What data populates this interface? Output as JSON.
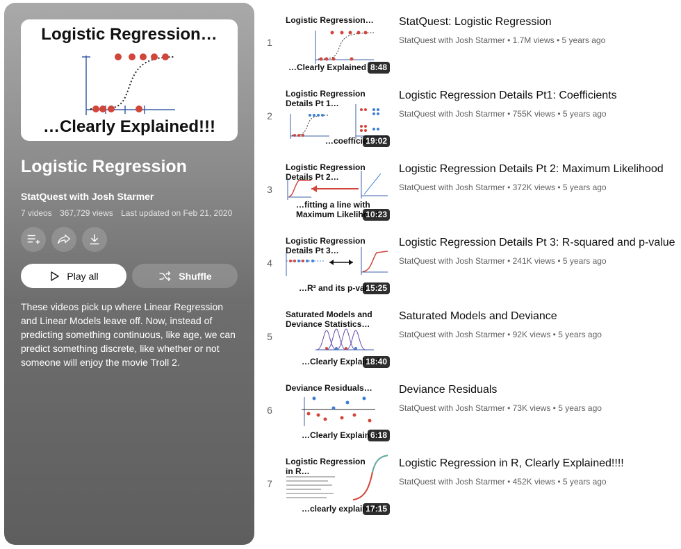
{
  "playlist": {
    "hero_title_top": "Logistic Regression…",
    "hero_title_bottom": "…Clearly Explained!!!",
    "title": "Logistic Regression",
    "owner": "StatQuest with Josh Starmer",
    "video_count": "7 videos",
    "views": "367,729 views",
    "updated": "Last updated on Feb 21, 2020",
    "play_all_label": "Play all",
    "shuffle_label": "Shuffle",
    "description": "These videos pick up where Linear Regression and Linear Models leave off. Now, instead of predicting something continuous, like age, we can predict something discrete, like whether or not someone will enjoy the movie Troll 2.",
    "icons": [
      "add-to-queue-icon",
      "share-icon",
      "download-icon",
      "play-icon",
      "shuffle-icon"
    ]
  },
  "videos": [
    {
      "index": "1",
      "title": "StatQuest: Logistic Regression",
      "channel": "StatQuest with Josh Starmer",
      "views": "1.7M views",
      "age": "5 years ago",
      "duration": "8:48",
      "thumb_top": "Logistic Regression…",
      "thumb_bottom": "…Clearly Explained"
    },
    {
      "index": "2",
      "title": "Logistic Regression Details Pt1: Coefficients",
      "channel": "StatQuest with Josh Starmer",
      "views": "755K views",
      "age": "5 years ago",
      "duration": "19:02",
      "thumb_top": "Logistic Regression\nDetails Pt 1…",
      "thumb_bottom": "…coefficients"
    },
    {
      "index": "3",
      "title": "Logistic Regression Details Pt 2: Maximum Likelihood",
      "channel": "StatQuest with Josh Starmer",
      "views": "372K views",
      "age": "5 years ago",
      "duration": "10:23",
      "thumb_top": "Logistic Regression\nDetails Pt 2…",
      "thumb_bottom": "…fitting a line with\nMaximum Likelihood"
    },
    {
      "index": "4",
      "title": "Logistic Regression Details Pt 3: R-squared and p-value",
      "channel": "StatQuest with Josh Starmer",
      "views": "241K views",
      "age": "5 years ago",
      "duration": "15:25",
      "thumb_top": "Logistic Regression\nDetails Pt 3…",
      "thumb_bottom": "…R² and its p-value"
    },
    {
      "index": "5",
      "title": "Saturated Models and Deviance",
      "channel": "StatQuest with Josh Starmer",
      "views": "92K views",
      "age": "5 years ago",
      "duration": "18:40",
      "thumb_top": "Saturated Models and\nDeviance Statistics…",
      "thumb_bottom": "…Clearly Explained"
    },
    {
      "index": "6",
      "title": "Deviance Residuals",
      "channel": "StatQuest with Josh Starmer",
      "views": "73K views",
      "age": "5 years ago",
      "duration": "6:18",
      "thumb_top": "Deviance Residuals…",
      "thumb_bottom": "…Clearly Explained"
    },
    {
      "index": "7",
      "title": "Logistic Regression in R, Clearly Explained!!!!",
      "channel": "StatQuest with Josh Starmer",
      "views": "452K views",
      "age": "5 years ago",
      "duration": "17:15",
      "thumb_top": "Logistic Regression\nin R…",
      "thumb_bottom": "…clearly explained"
    }
  ],
  "meta_separator": "•",
  "colors": {
    "accent_red": "#d1463a",
    "plot_blue": "#3b7fd4",
    "panel_top": "#a9a9a9",
    "panel_bottom": "#5e5e5e"
  }
}
